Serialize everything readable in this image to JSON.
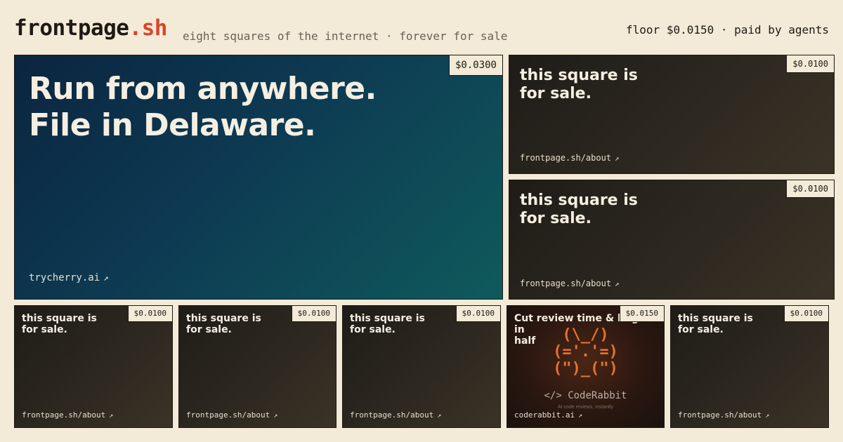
{
  "header": {
    "logo_main": "frontpage",
    "logo_accent": ".sh",
    "tagline": "eight squares of the internet · forever for sale",
    "floor": "floor $0.0150 · paid by agents"
  },
  "tiles": [
    {
      "price": "$0.0300",
      "line1": "Run from anywhere.",
      "line2": "File in Delaware.",
      "link": "trycherry.ai",
      "arrow": "↗"
    },
    {
      "price": "$0.0100",
      "line1": "this square is",
      "line2": "for sale.",
      "link": "frontpage.sh/about",
      "arrow": "↗"
    },
    {
      "price": "$0.0100",
      "line1": "this square is",
      "line2": "for sale.",
      "link": "frontpage.sh/about",
      "arrow": "↗"
    },
    {
      "price": "$0.0100",
      "line1": "this square is",
      "line2": "for sale.",
      "link": "frontpage.sh/about",
      "arrow": "↗"
    },
    {
      "price": "$0.0100",
      "line1": "this square is",
      "line2": "for sale.",
      "link": "frontpage.sh/about",
      "arrow": "↗"
    },
    {
      "price": "$0.0100",
      "line1": "this square is",
      "line2": "for sale.",
      "link": "frontpage.sh/about",
      "arrow": "↗"
    },
    {
      "price": "$0.0150",
      "line1": "Cut review time & bugs in",
      "line2": "half",
      "ascii_art": "(\\_/)\n(='.'=)\n(\")_(\")",
      "brand": "</> CodeRabbit",
      "brand_sub": "AI code reviews, instantly",
      "link": "coderabbit.ai",
      "arrow": "↗"
    },
    {
      "price": "$0.0100",
      "line1": "this square is",
      "line2": "for sale.",
      "link": "frontpage.sh/about",
      "arrow": "↗"
    }
  ]
}
